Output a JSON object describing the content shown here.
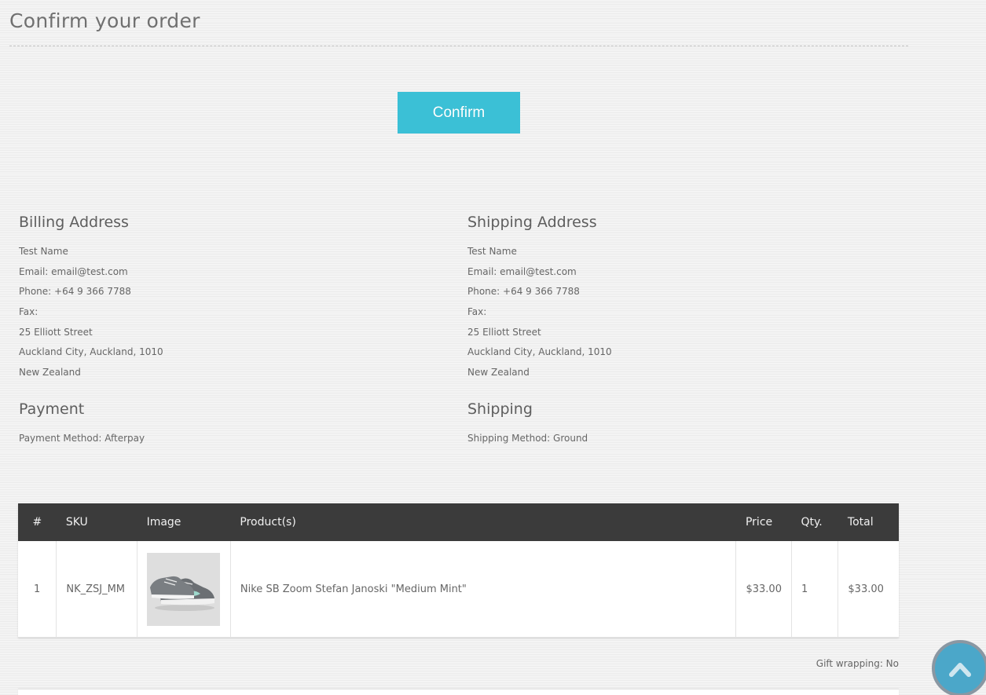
{
  "page": {
    "title": "Confirm your order",
    "confirm_label": "Confirm"
  },
  "billing": {
    "heading": "Billing Address",
    "name": "Test Name",
    "email": "Email: email@test.com",
    "phone": "Phone: +64 9 366 7788",
    "fax": "Fax:",
    "street": "25 Elliott Street",
    "city": "Auckland City, Auckland, 1010",
    "country": "New Zealand"
  },
  "shipping_address": {
    "heading": "Shipping Address",
    "name": "Test Name",
    "email": "Email: email@test.com",
    "phone": "Phone: +64 9 366 7788",
    "fax": "Fax:",
    "street": "25 Elliott Street",
    "city": "Auckland City, Auckland, 1010",
    "country": "New Zealand"
  },
  "payment": {
    "heading": "Payment",
    "method": "Payment Method: Afterpay"
  },
  "shipping": {
    "heading": "Shipping",
    "method": "Shipping Method: Ground"
  },
  "table": {
    "headers": {
      "num": "#",
      "sku": "SKU",
      "image": "Image",
      "product": "Product(s)",
      "price": "Price",
      "qty": "Qty.",
      "total": "Total"
    },
    "rows": [
      {
        "num": "1",
        "sku": "NK_ZSJ_MM",
        "product": "Nike SB Zoom Stefan Janoski \"Medium Mint\"",
        "price": "$33.00",
        "qty": "1",
        "total": "$33.00"
      }
    ]
  },
  "gift_wrapping": "Gift wrapping: No",
  "icons": {
    "scroll_top": "chevron-up-icon",
    "product_image": "sneaker-image"
  },
  "colors": {
    "accent": "#3bc0d6",
    "table_header": "#3b3b3b",
    "total_link": "#3fa9c6"
  }
}
